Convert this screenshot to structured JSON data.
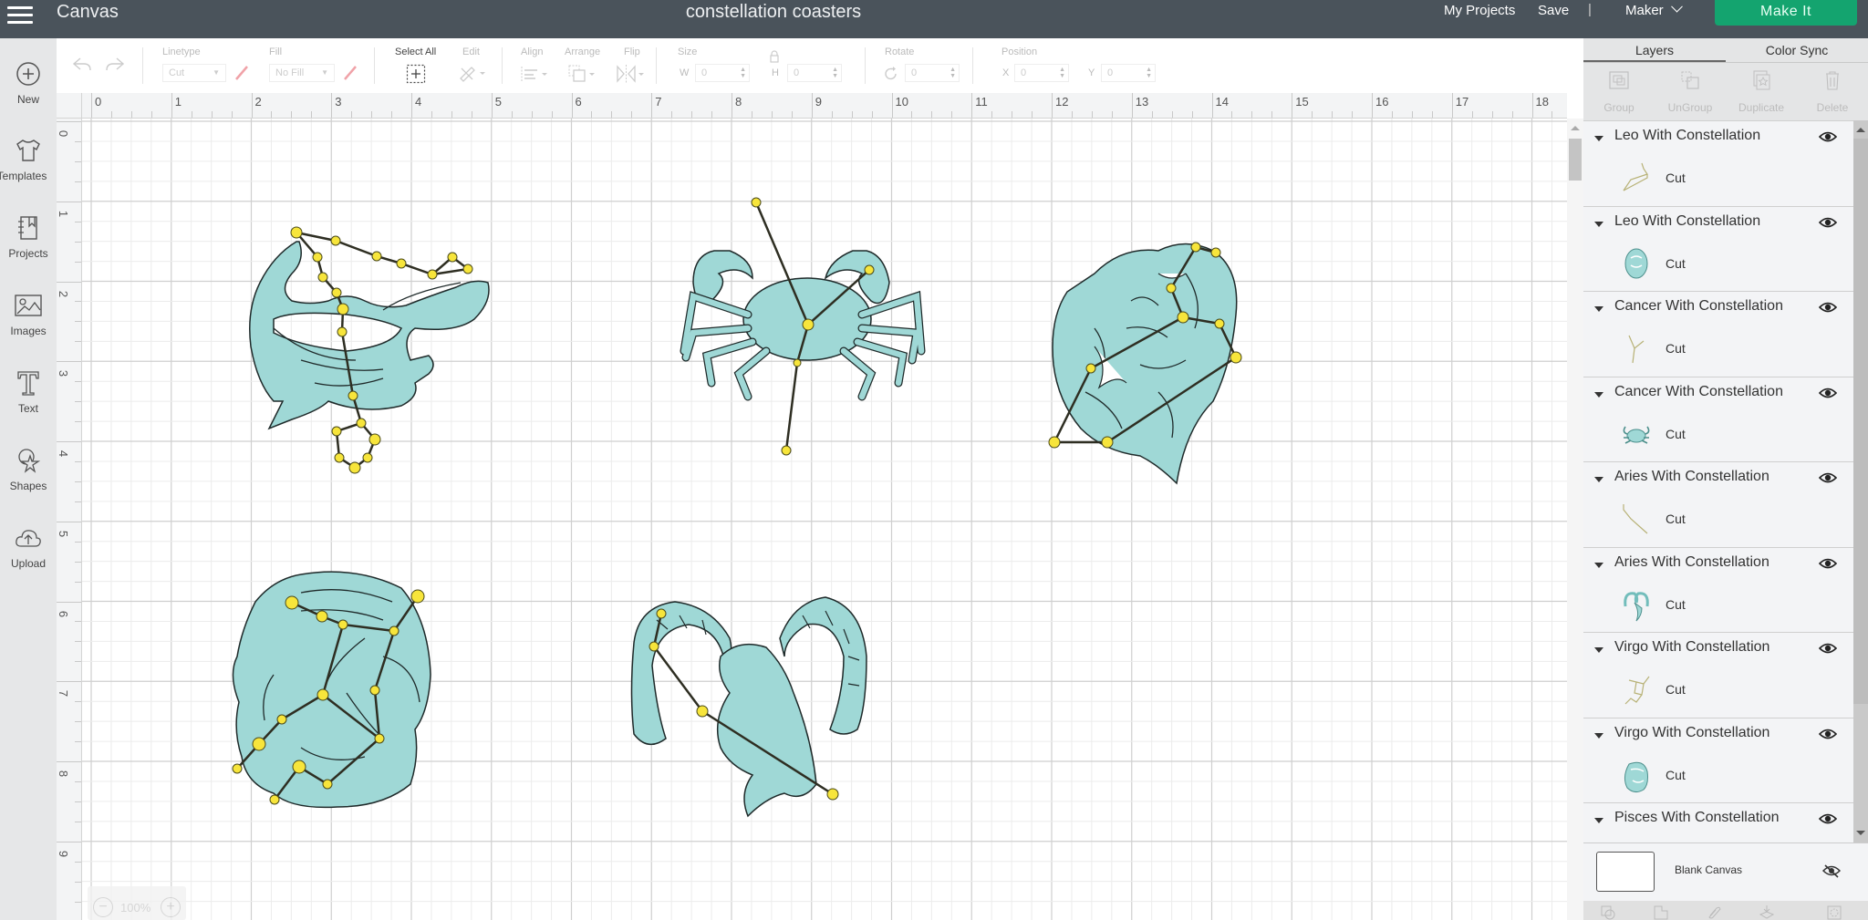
{
  "header": {
    "app_title": "Canvas",
    "project_title": "constellation coasters",
    "my_projects": "My Projects",
    "save": "Save",
    "separator": "|",
    "machine": "Maker",
    "make_it": "Make It"
  },
  "sidebar": {
    "items": [
      {
        "label": "New",
        "icon": "plus-circle-icon"
      },
      {
        "label": "Templates",
        "icon": "tshirt-icon"
      },
      {
        "label": "Projects",
        "icon": "notebook-icon"
      },
      {
        "label": "Images",
        "icon": "image-icon"
      },
      {
        "label": "Text",
        "icon": "text-T-icon"
      },
      {
        "label": "Shapes",
        "icon": "shapes-icon"
      },
      {
        "label": "Upload",
        "icon": "cloud-upload-icon"
      }
    ]
  },
  "toolbar": {
    "linetype_label": "Linetype",
    "linetype_value": "Cut",
    "fill_label": "Fill",
    "fill_value": "No Fill",
    "select_all": "Select All",
    "edit": "Edit",
    "align": "Align",
    "arrange": "Arrange",
    "flip": "Flip",
    "size_label": "Size",
    "w_label": "W",
    "w_value": "0",
    "h_label": "H",
    "h_value": "0",
    "rotate_label": "Rotate",
    "rotate_value": "0",
    "position_label": "Position",
    "x_label": "X",
    "x_value": "0",
    "y_label": "Y",
    "y_value": "0"
  },
  "rulers": {
    "horizontal": [
      "0",
      "1",
      "2",
      "3",
      "4",
      "5",
      "6",
      "7",
      "8",
      "9",
      "10",
      "11",
      "12",
      "13",
      "14",
      "15",
      "16",
      "17",
      "18"
    ],
    "vertical": [
      "0",
      "1",
      "2",
      "3",
      "4",
      "5",
      "6",
      "7",
      "8",
      "9"
    ]
  },
  "canvas": {
    "zoom_level": "100%",
    "fill_color": "#9fd8d6",
    "star_color": "#f7e53b",
    "line_color": "#2e2e22",
    "designs": [
      {
        "name": "Pisces",
        "label": "pisces-fish"
      },
      {
        "name": "Cancer",
        "label": "cancer-crab"
      },
      {
        "name": "Leo",
        "label": "leo-lion"
      },
      {
        "name": "Virgo",
        "label": "virgo-face"
      },
      {
        "name": "Aries",
        "label": "aries-ram"
      }
    ]
  },
  "right_panel": {
    "tabs": [
      "Layers",
      "Color Sync"
    ],
    "actions": [
      "Group",
      "UnGroup",
      "Duplicate",
      "Delete"
    ],
    "layers": [
      {
        "name": "Leo With Constellation",
        "type": "Cut",
        "thumb": "leo-constellation"
      },
      {
        "name": "Leo With Constellation",
        "type": "Cut",
        "thumb": "leo-image"
      },
      {
        "name": "Cancer With Constellation",
        "type": "Cut",
        "thumb": "cancer-constellation"
      },
      {
        "name": "Cancer With Constellation",
        "type": "Cut",
        "thumb": "cancer-image"
      },
      {
        "name": "Aries With Constellation",
        "type": "Cut",
        "thumb": "aries-constellation"
      },
      {
        "name": "Aries With Constellation",
        "type": "Cut",
        "thumb": "aries-image"
      },
      {
        "name": "Virgo With Constellation",
        "type": "Cut",
        "thumb": "virgo-constellation"
      },
      {
        "name": "Virgo With Constellation",
        "type": "Cut",
        "thumb": "virgo-image"
      },
      {
        "name": "Pisces With Constellation",
        "type": "",
        "thumb": ""
      }
    ],
    "blank_canvas": "Blank Canvas"
  }
}
